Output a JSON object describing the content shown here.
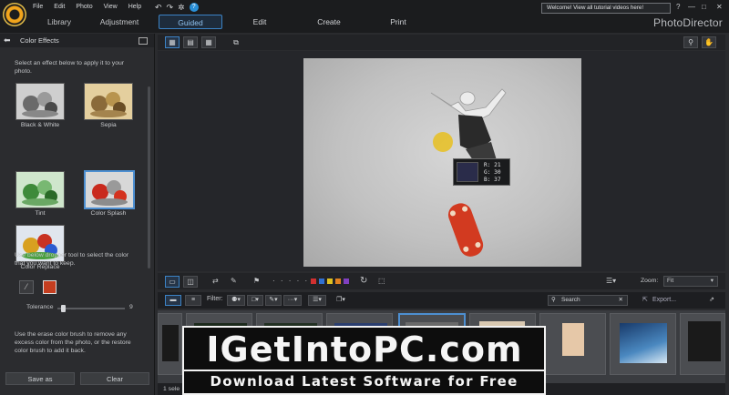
{
  "menu": [
    "File",
    "Edit",
    "Photo",
    "View",
    "Help"
  ],
  "mode_tabs": [
    "Library",
    "Adjustment"
  ],
  "main_tabs": [
    "Guided",
    "Edit",
    "Create",
    "Print"
  ],
  "welcome_text": "Welcome! View all tutorial videos here!",
  "brand": "PhotoDirector",
  "window_controls": [
    "?",
    "—",
    "□",
    "✕"
  ],
  "left_panel": {
    "title": "Color Effects",
    "instruction": "Select an effect below to apply it to your photo.",
    "effects": [
      {
        "label": "Black & White",
        "selected": false
      },
      {
        "label": "Sepia",
        "selected": false
      },
      {
        "label": "Tint",
        "selected": false
      },
      {
        "label": "Color Splash",
        "selected": true
      },
      {
        "label": "Color Replace",
        "selected": false
      }
    ],
    "dropper_text": "Use below dropper tool to select the color that you want to keep.",
    "selected_color": "#c43e20",
    "tolerance_label": "Tolerance",
    "tolerance_value": "9",
    "tolerance_fraction": 0.06,
    "brush_text": "Use the erase color brush to remove any excess color from the photo, or the restore color brush to add it back.",
    "save_as_label": "Save as",
    "clear_label": "Clear"
  },
  "picker": {
    "r": "R: 21",
    "g": "G: 30",
    "b": "B: 37"
  },
  "edit_toolbar": {
    "zoom_label": "Zoom:",
    "zoom_value": "Fit",
    "color_labels": [
      "#d03030",
      "#3070d0",
      "#e0c020",
      "#e08020",
      "#8040c0"
    ]
  },
  "filter_bar": {
    "filter_label": "Filter:",
    "search_placeholder": "Search",
    "export_label": "Export..."
  },
  "status": "1 sele",
  "watermark": {
    "title_1": "IGetIntoPC",
    "title_2": ".com",
    "subtitle": "Download Latest Software for Free"
  }
}
